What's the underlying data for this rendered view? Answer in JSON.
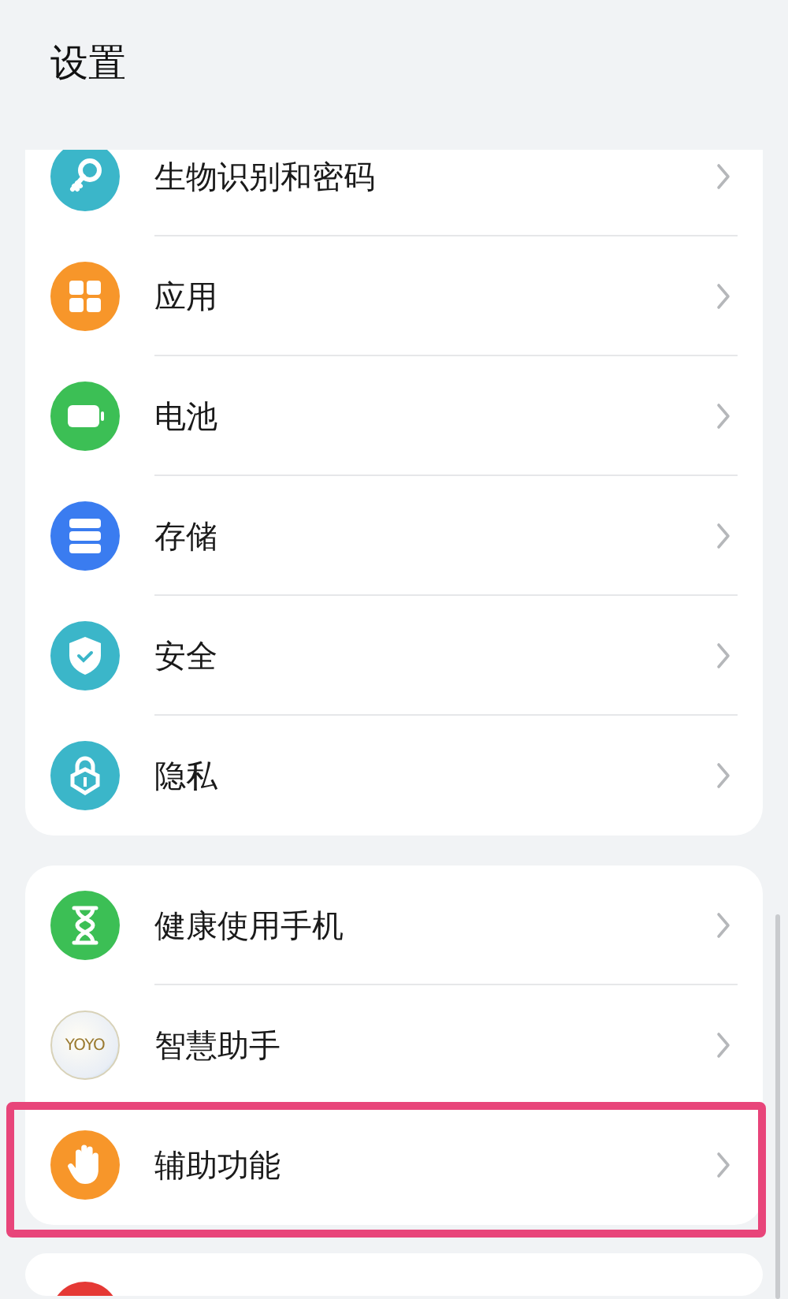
{
  "title": "设置",
  "groups": [
    {
      "items": [
        {
          "kind": "key",
          "label": "生物识别和密码",
          "highlighted": false
        },
        {
          "kind": "apps",
          "label": "应用",
          "highlighted": false
        },
        {
          "kind": "battery",
          "label": "电池",
          "highlighted": false
        },
        {
          "kind": "storage",
          "label": "存储",
          "highlighted": false
        },
        {
          "kind": "shield",
          "label": "安全",
          "highlighted": false
        },
        {
          "kind": "lock",
          "label": "隐私",
          "highlighted": false
        }
      ]
    },
    {
      "items": [
        {
          "kind": "hourglass",
          "label": "健康使用手机",
          "highlighted": false
        },
        {
          "kind": "logo",
          "icon_text": "YOYO",
          "label": "智慧助手",
          "highlighted": false
        },
        {
          "kind": "hand",
          "label": "辅助功能",
          "highlighted": true
        }
      ]
    },
    {
      "items": [
        {
          "kind": "red"
        }
      ]
    }
  ]
}
